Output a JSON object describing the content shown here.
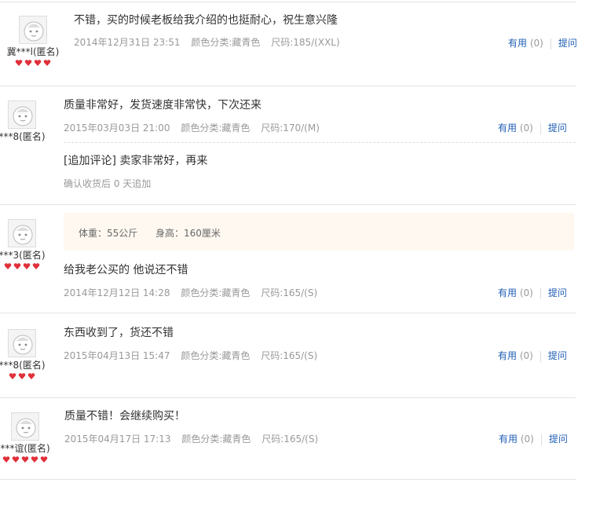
{
  "reviews": [
    {
      "nick": "冀***l(匿名)",
      "hearts": 4,
      "text": "不错，买的时候老板给我介绍的也挺耐心，祝生意兴隆",
      "date": "2014年12月31日 23:51",
      "color": "颜色分类:藏青色",
      "size": "尺码:185/(XXL)",
      "useful": "有用",
      "count": "(0)",
      "ask": "提问"
    },
    {
      "nick": "***8(匿名)",
      "hearts": 0,
      "text": "质量非常好，发货速度非常快，下次还来",
      "date": "2015年03月03日 21:00",
      "color": "颜色分类:藏青色",
      "size": "尺码:170/(M)",
      "useful": "有用",
      "count": "(0)",
      "ask": "提问",
      "followup": "[追加评论] 卖家非常好，再来",
      "followup_meta": "确认收货后 0 天追加"
    },
    {
      "nick": "***3(匿名)",
      "hearts": 4,
      "weight": "体重：55公斤",
      "height": "身高：160厘米",
      "text": "给我老公买的 他说还不错",
      "date": "2014年12月12日 14:28",
      "color": "颜色分类:藏青色",
      "size": "尺码:165/(S)",
      "useful": "有用",
      "count": "(0)",
      "ask": "提问"
    },
    {
      "nick": "***8(匿名)",
      "hearts": 3,
      "text": "东西收到了，货还不错",
      "date": "2015年04月13日 15:47",
      "color": "颜色分类:藏青色",
      "size": "尺码:165/(S)",
      "useful": "有用",
      "count": "(0)",
      "ask": "提问"
    },
    {
      "nick": "***谊(匿名)",
      "hearts": 5,
      "text": "质量不错！会继续购买！",
      "date": "2015年04月17日 17:13",
      "color": "颜色分类:藏青色",
      "size": "尺码:165/(S)",
      "useful": "有用",
      "count": "(0)",
      "ask": "提问"
    }
  ],
  "icons": {
    "avatar": "default-avatar-icon",
    "heart": "heart-level-icon"
  },
  "colors": {
    "link": "#1f5eb5",
    "heart": "#e0303a",
    "meta": "#999999"
  }
}
